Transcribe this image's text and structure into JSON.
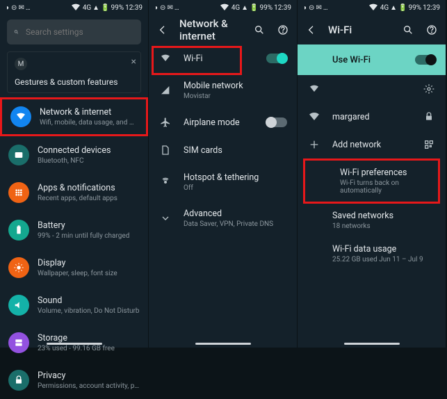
{
  "status": {
    "signal": "4G",
    "battery": "99%",
    "time": "12:39"
  },
  "p1": {
    "search_placeholder": "Search settings",
    "gesture": "Gestures & custom features",
    "items": [
      {
        "t": "Network & internet",
        "s": "Wifi, mobile, data usage, and hotspot",
        "c": "#1285f0"
      },
      {
        "t": "Connected devices",
        "s": "Bluetooth, NFC",
        "c": "#1a6e6a"
      },
      {
        "t": "Apps & notifications",
        "s": "Recent apps, default apps",
        "c": "#f06314"
      },
      {
        "t": "Battery",
        "s": "99% - 2 min until fully charged",
        "c": "#14a88f"
      },
      {
        "t": "Display",
        "s": "Wallpaper, sleep, font size",
        "c": "#f06314"
      },
      {
        "t": "Sound",
        "s": "Volume, vibration, Do Not Disturb",
        "c": "#14b2a8"
      },
      {
        "t": "Storage",
        "s": "23% used - 99.16 GB free",
        "c": "#9352e0"
      },
      {
        "t": "Privacy",
        "s": "Permissions, account activity, personal data",
        "c": "#1a6e6a"
      }
    ]
  },
  "p2": {
    "title": "Network & internet",
    "items": [
      {
        "t": "Wi-Fi",
        "s": "",
        "toggle": "on"
      },
      {
        "t": "Mobile network",
        "s": "Movistar"
      },
      {
        "t": "Airplane mode",
        "s": "",
        "toggle": "off"
      },
      {
        "t": "SIM cards",
        "s": ""
      },
      {
        "t": "Hotspot & tethering",
        "s": "Off"
      },
      {
        "t": "Advanced",
        "s": "Data Saver, VPN, Private DNS"
      }
    ]
  },
  "p3": {
    "title": "Wi-Fi",
    "usewifi": "Use Wi-Fi",
    "net": "margared",
    "add": "Add network",
    "pref_t": "Wi-Fi preferences",
    "pref_s": "Wi-Fi turns back on automatically",
    "saved_t": "Saved networks",
    "saved_s": "18 networks",
    "usage_t": "Wi-Fi data usage",
    "usage_s": "25.22 GB used Jun 11 – Jul 9"
  }
}
